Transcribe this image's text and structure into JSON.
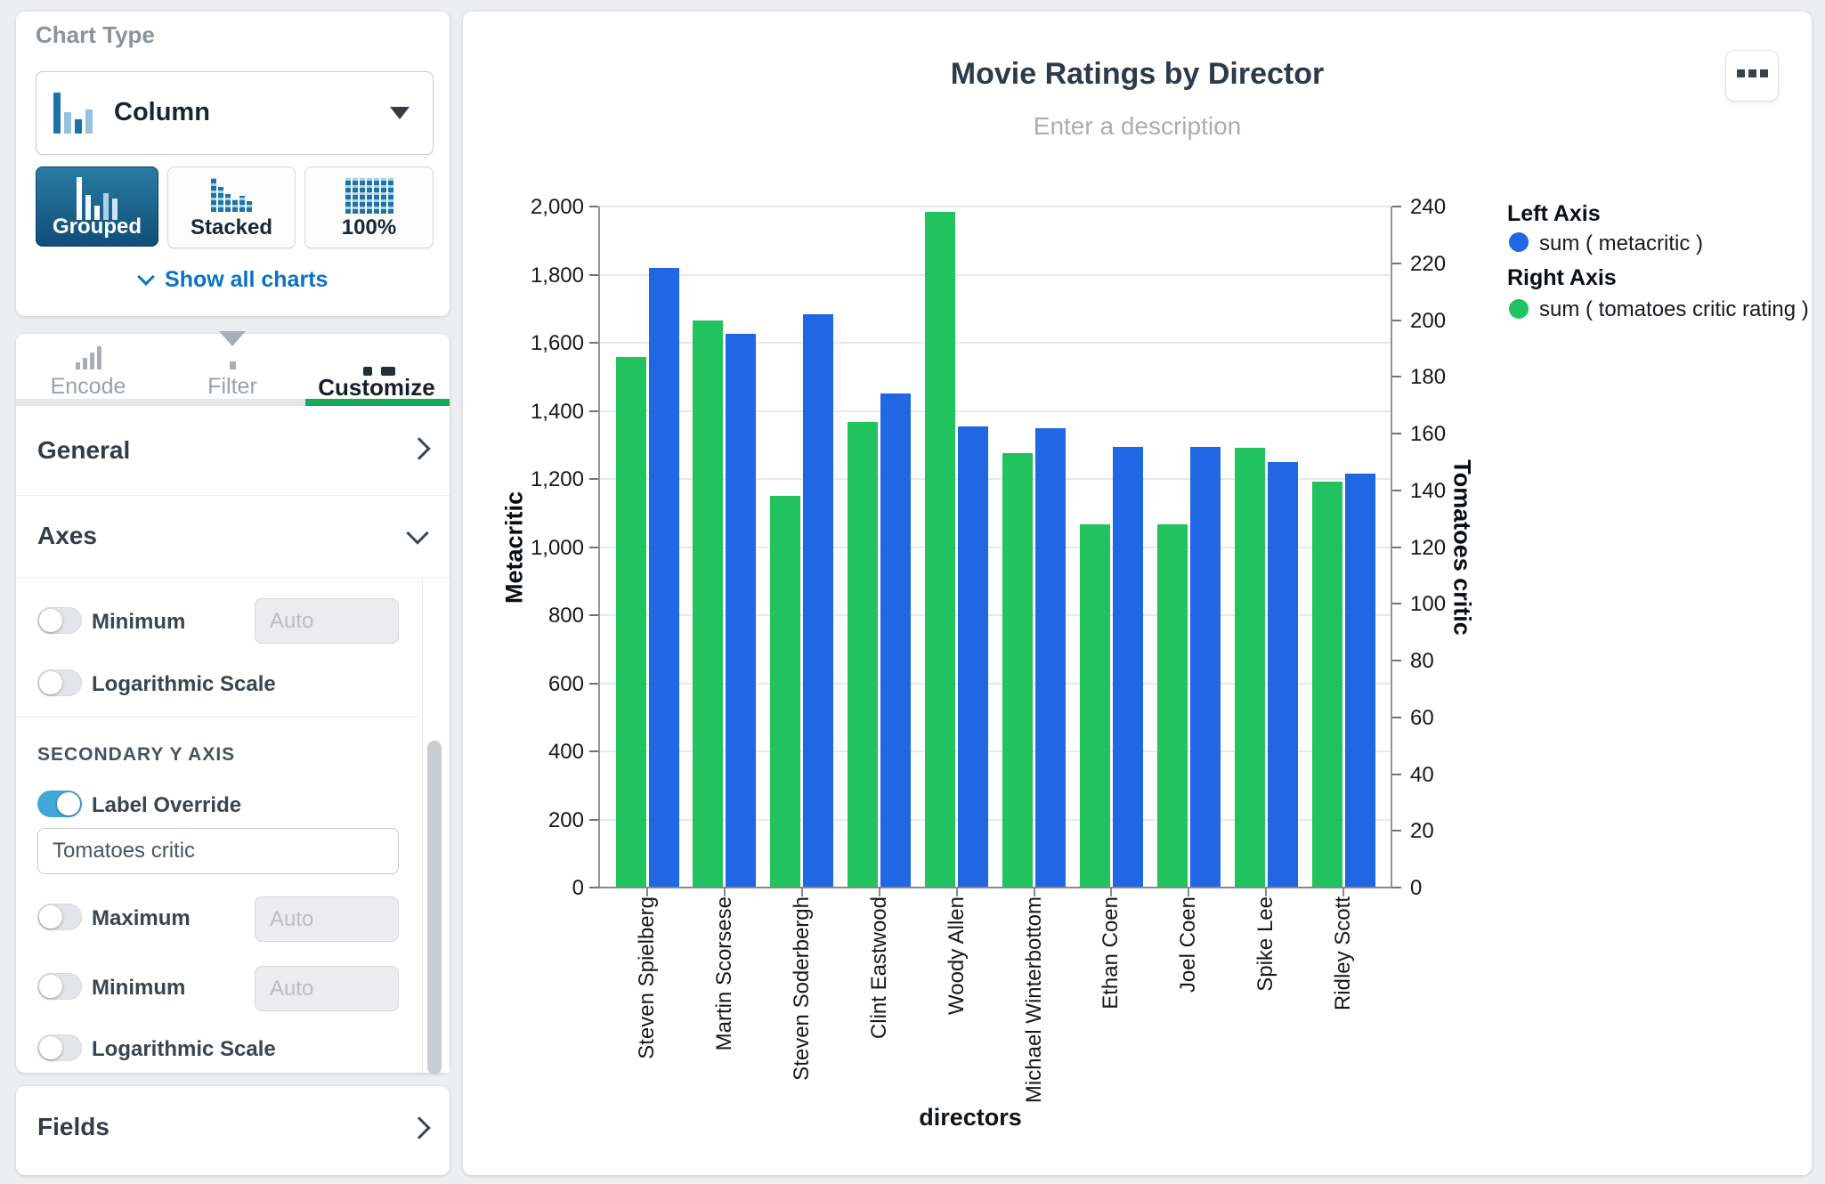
{
  "sidebar": {
    "chart_type": {
      "title": "Chart Type",
      "selected": "Column",
      "variants": [
        {
          "label": "Grouped",
          "active": true
        },
        {
          "label": "Stacked",
          "active": false
        },
        {
          "label": "100%",
          "active": false
        }
      ],
      "show_all": "Show all charts"
    },
    "tabs": [
      {
        "label": "Encode",
        "active": false
      },
      {
        "label": "Filter",
        "active": false
      },
      {
        "label": "Customize",
        "active": true
      }
    ],
    "sections": {
      "general": "General",
      "axes": "Axes",
      "fields": "Fields"
    },
    "axes_panel": {
      "primary_minimum_label": "Minimum",
      "primary_log_label": "Logarithmic Scale",
      "secondary_header": "SECONDARY Y AXIS",
      "label_override_label": "Label Override",
      "label_override_value": "Tomatoes critic",
      "maximum_label": "Maximum",
      "minimum_label": "Minimum",
      "log_label": "Logarithmic Scale",
      "auto_placeholder": "Auto"
    }
  },
  "chart": {
    "title": "Movie Ratings by Director",
    "description_placeholder": "Enter a description",
    "legend": {
      "left_header": "Left Axis",
      "left_item": "sum ( metacritic )",
      "right_header": "Right Axis",
      "right_item": "sum ( tomatoes critic rating )"
    }
  },
  "chart_data": {
    "type": "bar",
    "title": "Movie Ratings by Director",
    "categories": [
      "Steven Spielberg",
      "Martin Scorsese",
      "Steven Soderbergh",
      "Clint Eastwood",
      "Woody Allen",
      "Michael Winterbottom",
      "Ethan Coen",
      "Joel Coen",
      "Spike Lee",
      "Ridley Scott"
    ],
    "series": [
      {
        "name": "sum ( tomatoes critic rating )",
        "axis": "right",
        "color": "#20c35d",
        "values": [
          187,
          200,
          138,
          164,
          238,
          153,
          128,
          128,
          155,
          143
        ]
      },
      {
        "name": "sum ( metacritic )",
        "axis": "left",
        "color": "#2166e3",
        "values": [
          1820,
          1625,
          1685,
          1450,
          1355,
          1350,
          1295,
          1295,
          1250,
          1215
        ]
      }
    ],
    "xlabel": "directors",
    "left_axis": {
      "label": "Metacritic",
      "min": 0,
      "max": 2000,
      "tick_step": 200
    },
    "right_axis": {
      "label": "Tomatoes critic",
      "min": 0,
      "max": 240,
      "tick_step": 20
    },
    "grid": true,
    "legend_position": "right"
  },
  "colors": {
    "bar_blue": "#2166e3",
    "bar_green": "#20c35d",
    "accent_green": "#16a95a",
    "toggle_on": "#41a7d7",
    "link_blue": "#0b72c6"
  }
}
